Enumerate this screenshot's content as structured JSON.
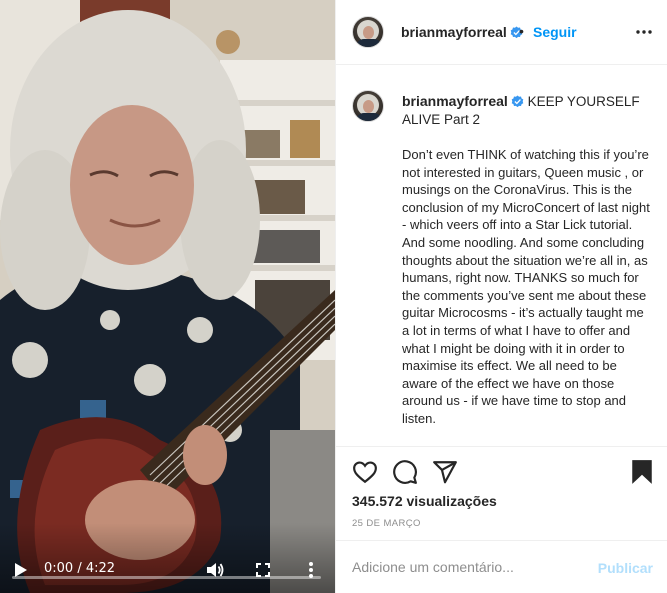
{
  "video": {
    "current_time": "0:00",
    "duration": "4:22",
    "time_label": "0:00 / 4:22",
    "progress": 0
  },
  "header": {
    "username": "brianmayforreal",
    "separator": "•",
    "follow_label": "Seguir"
  },
  "caption": {
    "username": "brianmayforreal",
    "title": "KEEP YOURSELF ALIVE Part 2",
    "body": "Don’t even THINK of watching this if you’re not interested in guitars, Queen music , or musings on the CoronaVirus. This is the conclusion of my MicroConcert of last night - which veers off into a Star Lick tutorial. And some noodling. And some concluding thoughts about the situation we’re all in, as humans, right now. THANKS so much for the comments you’ve sent me about these guitar Microcosms - it’s actually taught me a lot in terms of what I have to offer and what I might be doing with it in order to maximise its effect. We all need to be aware of the effect we have on those around us - if we have time to stop and listen."
  },
  "stats": {
    "views": "345.572 visualizações",
    "date": "25 DE MARÇO"
  },
  "comment_box": {
    "placeholder": "Adicione um comentário...",
    "publish_label": "Publicar"
  },
  "colors": {
    "accent": "#0095f6",
    "publish_disabled": "#b2dffc",
    "text": "#262626",
    "muted": "#8e8e8e",
    "border": "#efefef"
  },
  "icons": [
    "verified-badge-icon",
    "more-options-icon",
    "heart-icon",
    "comment-icon",
    "share-icon",
    "bookmark-icon",
    "play-icon",
    "volume-icon",
    "fullscreen-icon"
  ]
}
